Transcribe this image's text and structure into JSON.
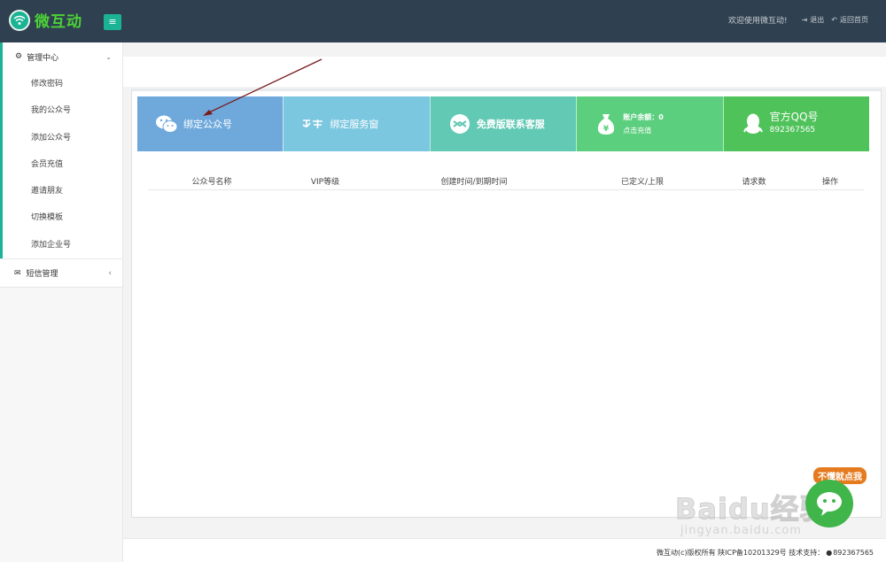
{
  "header": {
    "logo_text": "微互动",
    "logo_badge": "weiHu",
    "menu_toggle": "≡",
    "welcome": "欢迎使用微互动!",
    "logout": "退出",
    "home": "返回首页"
  },
  "sidebar": {
    "group_title": "管理中心",
    "items": [
      {
        "label": "修改密码"
      },
      {
        "label": "我的公众号"
      },
      {
        "label": "添加公众号"
      },
      {
        "label": "会员充值"
      },
      {
        "label": "邀请朋友"
      },
      {
        "label": "切换模板"
      },
      {
        "label": "添加企业号"
      }
    ],
    "sms_title": "短信管理"
  },
  "tiles": [
    {
      "label": "绑定公众号",
      "color": "#6fa9dc",
      "icon": "wechat-icon"
    },
    {
      "label": "绑定服务窗",
      "color": "#7cc7e0",
      "icon": "alipay-icon"
    },
    {
      "label": "免费版联系客服",
      "color": "#62c9b4",
      "icon": "service-icon"
    },
    {
      "line1": "账户余额：0",
      "line2": "点击充值",
      "color": "#5ccf7f",
      "icon": "money-bag-icon"
    },
    {
      "line1": "官方QQ号",
      "line2": "892367565",
      "color": "#4fc25a",
      "icon": "qq-icon"
    }
  ],
  "table": {
    "columns": [
      "公众号名称",
      "VIP等级",
      "创建时间/到期时间",
      "已定义/上限",
      "请求数",
      "操作"
    ]
  },
  "footer": {
    "copyright": "微互动(c)版权所有 陕ICP备10201329号 技术支持：",
    "qq": "892367565"
  },
  "help_widget": {
    "label": "不懂就点我"
  },
  "watermark": {
    "brand": "Baidu经验",
    "url": "jingyan.baidu.com"
  }
}
